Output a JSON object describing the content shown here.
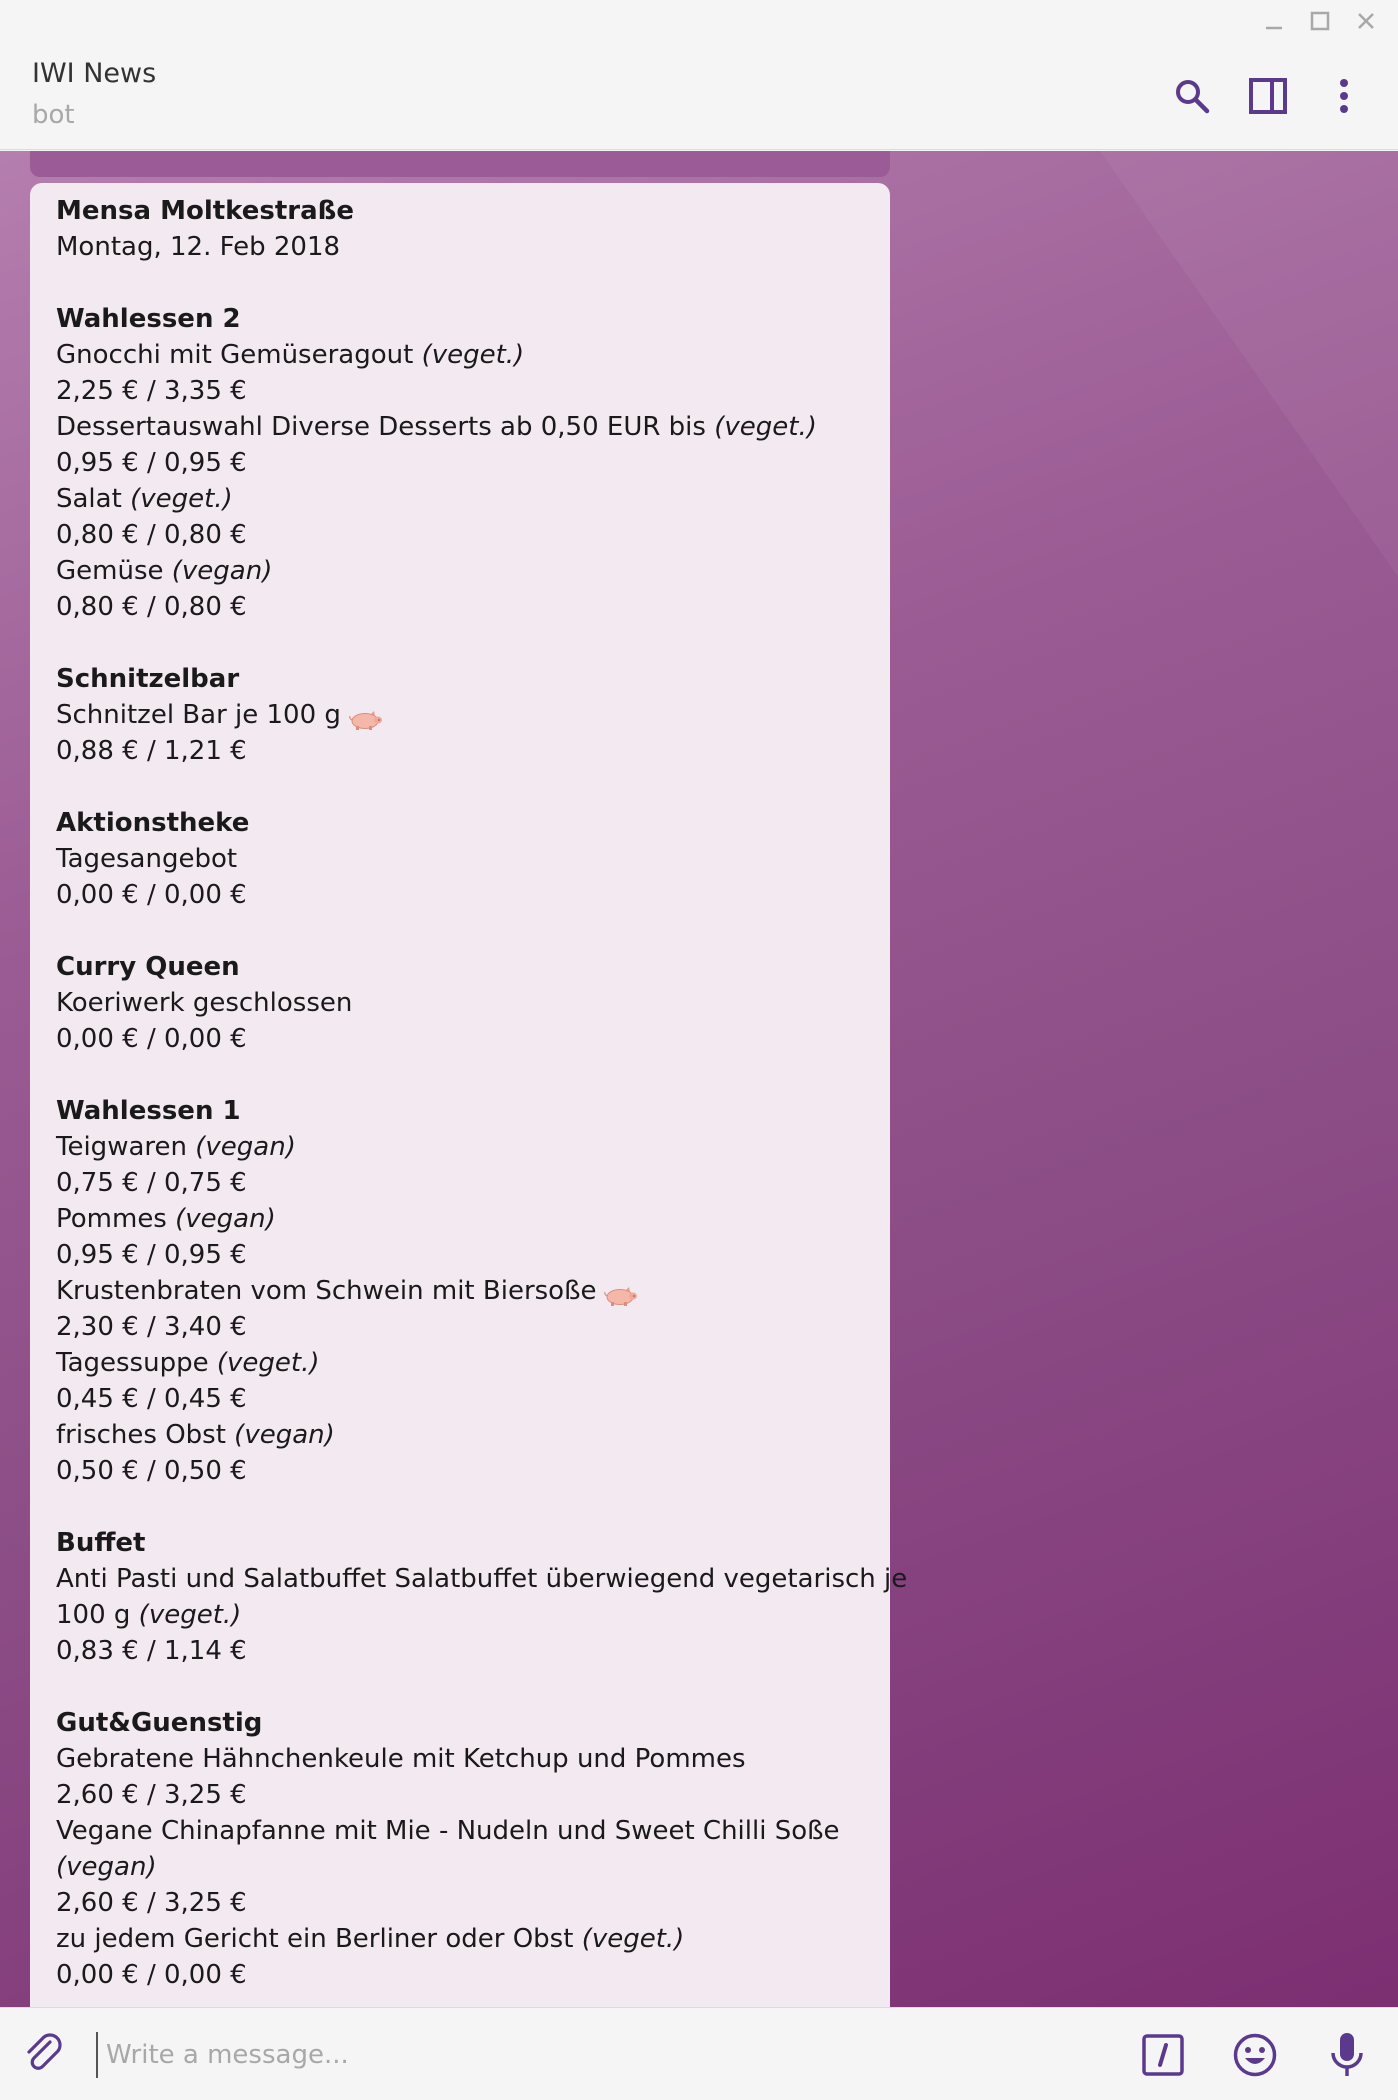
{
  "chat": {
    "name": "IWI News",
    "status": "bot"
  },
  "composer": {
    "placeholder": "Write a message..."
  },
  "message": {
    "lines": [
      {
        "type": "heading",
        "text": "Mensa Moltkestraße"
      },
      {
        "type": "text",
        "text": "Montag, 12. Feb 2018"
      },
      {
        "type": "gap"
      },
      {
        "type": "heading",
        "text": "Wahlessen 2"
      },
      {
        "type": "text",
        "text": "Gnocchi mit Gemüseragout ",
        "tag": "(veget.)"
      },
      {
        "type": "text",
        "text": "2,25 € / 3,35 €"
      },
      {
        "type": "text",
        "text": "Dessertauswahl Diverse Desserts ab 0,50 EUR bis ",
        "tag": "(veget.)"
      },
      {
        "type": "text",
        "text": "0,95 € / 0,95 €"
      },
      {
        "type": "text",
        "text": "Salat ",
        "tag": "(veget.)"
      },
      {
        "type": "text",
        "text": "0,80 € / 0,80 €"
      },
      {
        "type": "text",
        "text": "Gemüse ",
        "tag": "(vegan)"
      },
      {
        "type": "text",
        "text": "0,80 € / 0,80 €"
      },
      {
        "type": "gap"
      },
      {
        "type": "heading",
        "text": "Schnitzelbar"
      },
      {
        "type": "text",
        "text": "Schnitzel Bar je 100 g",
        "pig": true
      },
      {
        "type": "text",
        "text": "0,88 € / 1,21 €"
      },
      {
        "type": "gap"
      },
      {
        "type": "heading",
        "text": "Aktionstheke"
      },
      {
        "type": "text",
        "text": "Tagesangebot"
      },
      {
        "type": "text",
        "text": "0,00 € / 0,00 €"
      },
      {
        "type": "gap"
      },
      {
        "type": "heading",
        "text": "Curry Queen"
      },
      {
        "type": "text",
        "text": "Koeriwerk geschlossen"
      },
      {
        "type": "text",
        "text": "0,00 € / 0,00 €"
      },
      {
        "type": "gap"
      },
      {
        "type": "heading",
        "text": "Wahlessen 1"
      },
      {
        "type": "text",
        "text": "Teigwaren ",
        "tag": "(vegan)"
      },
      {
        "type": "text",
        "text": "0,75 € / 0,75 €"
      },
      {
        "type": "text",
        "text": "Pommes ",
        "tag": "(vegan)"
      },
      {
        "type": "text",
        "text": "0,95 € / 0,95 €"
      },
      {
        "type": "text",
        "text": "Krustenbraten vom Schwein mit Biersoße",
        "pig": true
      },
      {
        "type": "text",
        "text": "2,30 € / 3,40 €"
      },
      {
        "type": "text",
        "text": "Tagessuppe ",
        "tag": "(veget.)"
      },
      {
        "type": "text",
        "text": "0,45 € / 0,45 €"
      },
      {
        "type": "text",
        "text": "frisches Obst ",
        "tag": "(vegan)"
      },
      {
        "type": "text",
        "text": "0,50 € / 0,50 €"
      },
      {
        "type": "gap"
      },
      {
        "type": "heading",
        "text": "Buffet"
      },
      {
        "type": "text",
        "text": "Anti Pasti und Salatbuffet Salatbuffet überwiegend vegetarisch je"
      },
      {
        "type": "text",
        "text": "100 g ",
        "tag": "(veget.)"
      },
      {
        "type": "text",
        "text": "0,83 € / 1,14 €"
      },
      {
        "type": "gap"
      },
      {
        "type": "heading",
        "text": "Gut&Guenstig"
      },
      {
        "type": "text",
        "text": "Gebratene Hähnchenkeule mit Ketchup und Pommes"
      },
      {
        "type": "text",
        "text": "2,60 € / 3,25 €"
      },
      {
        "type": "text",
        "text": "Vegane Chinapfanne mit Mie - Nudeln und Sweet Chilli Soße"
      },
      {
        "type": "text",
        "text": "",
        "tag": "(vegan)"
      },
      {
        "type": "text",
        "text": "2,60 € / 3,25 €"
      },
      {
        "type": "text",
        "text": "zu jedem Gericht ein Berliner oder Obst ",
        "tag": "(veget.)"
      },
      {
        "type": "text",
        "text": "0,00 € / 0,00 €"
      }
    ]
  },
  "icons": {
    "header": [
      "search-icon",
      "sidebar-toggle-icon",
      "more-vertical-icon"
    ],
    "window": [
      "minimize-icon",
      "maximize-icon",
      "close-icon"
    ],
    "composer": [
      "attach-icon",
      "bot-commands-icon",
      "emoji-icon",
      "microphone-icon"
    ]
  },
  "colors": {
    "accent": "#5b3a8e",
    "chat_bg_top": "#b47eae",
    "chat_bg_bottom": "#7c2f72",
    "bubble": "#f3e9f1"
  }
}
